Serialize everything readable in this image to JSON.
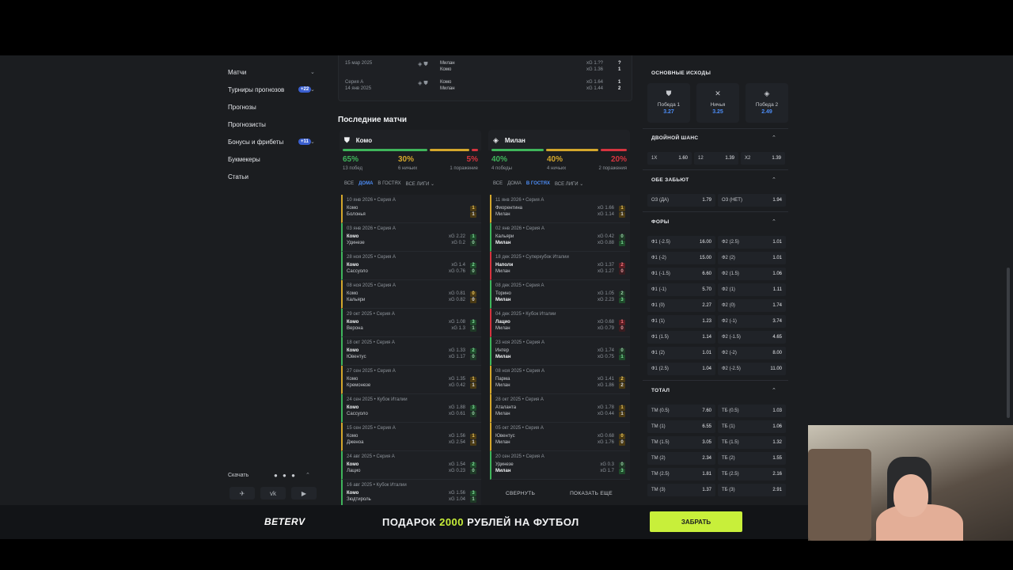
{
  "sidebar": {
    "items": [
      {
        "label": "Матчи",
        "chevron": "⌄"
      },
      {
        "label": "Турниры прогнозов",
        "badge": "+22",
        "chevron": "⌄"
      },
      {
        "label": "Прогнозы"
      },
      {
        "label": "Прогнозисты"
      },
      {
        "label": "Бонусы и фрибеты",
        "badge": "+11",
        "chevron": "⌄"
      },
      {
        "label": "Букмекеры"
      },
      {
        "label": "Статьи"
      }
    ],
    "download_label": "Скачать",
    "download_icons": "● ● ●",
    "socials": [
      "✈",
      "vk",
      "▶"
    ]
  },
  "h2h": [
    {
      "date": "15 мар 2025",
      "league": "",
      "team1": "Милан",
      "team2": "Комо",
      "xg1": "xG 1.??",
      "xg2": "xG 1.36",
      "s1": "?",
      "s2": "1"
    },
    {
      "date": "14 янв 2025",
      "league": "Серия А",
      "team1": "Комо",
      "team2": "Милан",
      "xg1": "xG 1.64",
      "xg2": "xG 1.44",
      "s1": "1",
      "s2": "2"
    }
  ],
  "recent_title": "Последние матчи",
  "teams": [
    {
      "name": "Комо",
      "crest": "⛊",
      "win_pct": "65%",
      "draw_pct": "30%",
      "loss_pct": "5%",
      "win_lbl": "13 побед",
      "draw_lbl": "6 ничьих",
      "loss_lbl": "1 поражение",
      "filters": [
        "ВСЕ",
        "ДОМА",
        "В ГОСТЯХ",
        "ВСЕ ЛИГИ ⌄"
      ],
      "active_filter": 1,
      "matches": [
        {
          "res": "d",
          "meta": "10 янв 2026 • Серия А",
          "t1": "Комо",
          "t2": "Болонья",
          "x1": "",
          "x2": "",
          "s1": "1",
          "s2": "1",
          "bold": 0
        },
        {
          "res": "w",
          "meta": "03 янв 2026 • Серия А",
          "t1": "Комо",
          "t2": "Удинезе",
          "x1": "xG 2.22",
          "x2": "xG 0.2",
          "s1": "1",
          "s2": "0",
          "bold": 1
        },
        {
          "res": "w",
          "meta": "28 ноя 2025 • Серия А",
          "t1": "Комо",
          "t2": "Сассуоло",
          "x1": "xG 1.4",
          "x2": "xG 0.76",
          "s1": "2",
          "s2": "0",
          "bold": 1
        },
        {
          "res": "d",
          "meta": "08 ноя 2025 • Серия А",
          "t1": "Комо",
          "t2": "Кальяри",
          "x1": "xG 0.81",
          "x2": "xG 0.82",
          "s1": "0",
          "s2": "0",
          "bold": 0
        },
        {
          "res": "w",
          "meta": "29 окт 2025 • Серия А",
          "t1": "Комо",
          "t2": "Верона",
          "x1": "xG 1.08",
          "x2": "xG 1.3",
          "s1": "3",
          "s2": "1",
          "bold": 1
        },
        {
          "res": "w",
          "meta": "18 окт 2025 • Серия А",
          "t1": "Комо",
          "t2": "Ювентус",
          "x1": "xG 1.33",
          "x2": "xG 1.17",
          "s1": "2",
          "s2": "0",
          "bold": 1
        },
        {
          "res": "d",
          "meta": "27 сен 2025 • Серия А",
          "t1": "Комо",
          "t2": "Кремонезе",
          "x1": "xG 1.35",
          "x2": "xG 0.42",
          "s1": "1",
          "s2": "1",
          "bold": 0
        },
        {
          "res": "w",
          "meta": "24 сен 2025 • Кубок Италии",
          "t1": "Комо",
          "t2": "Сассуоло",
          "x1": "xG 1.88",
          "x2": "xG 0.61",
          "s1": "3",
          "s2": "0",
          "bold": 1
        },
        {
          "res": "d",
          "meta": "15 сен 2025 • Серия А",
          "t1": "Комо",
          "t2": "Дженоа",
          "x1": "xG 1.56",
          "x2": "xG 2.54",
          "s1": "1",
          "s2": "1",
          "bold": 0
        },
        {
          "res": "w",
          "meta": "24 авг 2025 • Серия А",
          "t1": "Комо",
          "t2": "Лацио",
          "x1": "xG 1.54",
          "x2": "xG 0.23",
          "s1": "2",
          "s2": "0",
          "bold": 1
        },
        {
          "res": "w",
          "meta": "16 авг 2025 • Кубок Италии",
          "t1": "Комо",
          "t2": "Зюдтироль",
          "x1": "xG 1.56",
          "x2": "xG 1.04",
          "s1": "3",
          "s2": "1",
          "bold": 1
        }
      ]
    },
    {
      "name": "Милан",
      "crest": "◈",
      "win_pct": "40%",
      "draw_pct": "40%",
      "loss_pct": "20%",
      "win_lbl": "4 победы",
      "draw_lbl": "4 ничьих",
      "loss_lbl": "2 поражения",
      "filters": [
        "ВСЕ",
        "ДОМА",
        "В ГОСТЯХ",
        "ВСЕ ЛИГИ ⌄"
      ],
      "active_filter": 2,
      "matches": [
        {
          "res": "d",
          "meta": "11 янв 2026 • Серия А",
          "t1": "Фиорентина",
          "t2": "Милан",
          "x1": "xG 1.66",
          "x2": "xG 1.14",
          "s1": "1",
          "s2": "1",
          "bold": 0
        },
        {
          "res": "w",
          "meta": "02 янв 2026 • Серия А",
          "t1": "Кальяри",
          "t2": "Милан",
          "x1": "xG 0.42",
          "x2": "xG 0.88",
          "s1": "0",
          "s2": "1",
          "bold": 2
        },
        {
          "res": "l",
          "meta": "18 дек 2025 • Суперкубок Италии",
          "t1": "Наполи",
          "t2": "Милан",
          "x1": "xG 1.37",
          "x2": "xG 1.27",
          "s1": "2",
          "s2": "0",
          "bold": 1
        },
        {
          "res": "w",
          "meta": "08 дек 2025 • Серия А",
          "t1": "Торино",
          "t2": "Милан",
          "x1": "xG 1.05",
          "x2": "xG 2.23",
          "s1": "2",
          "s2": "3",
          "bold": 2
        },
        {
          "res": "l",
          "meta": "04 дек 2025 • Кубок Италии",
          "t1": "Лацио",
          "t2": "Милан",
          "x1": "xG 0.68",
          "x2": "xG 0.79",
          "s1": "1",
          "s2": "0",
          "bold": 1
        },
        {
          "res": "w",
          "meta": "23 ноя 2025 • Серия А",
          "t1": "Интер",
          "t2": "Милан",
          "x1": "xG 1.74",
          "x2": "xG 0.75",
          "s1": "0",
          "s2": "1",
          "bold": 2
        },
        {
          "res": "d",
          "meta": "08 ноя 2025 • Серия А",
          "t1": "Парма",
          "t2": "Милан",
          "x1": "xG 1.41",
          "x2": "xG 1.86",
          "s1": "2",
          "s2": "2",
          "bold": 0
        },
        {
          "res": "d",
          "meta": "28 окт 2025 • Серия А",
          "t1": "Аталанта",
          "t2": "Милан",
          "x1": "xG 1.78",
          "x2": "xG 0.44",
          "s1": "1",
          "s2": "1",
          "bold": 0
        },
        {
          "res": "d",
          "meta": "05 окт 2025 • Серия А",
          "t1": "Ювентус",
          "t2": "Милан",
          "x1": "xG 0.68",
          "x2": "xG 1.76",
          "s1": "0",
          "s2": "0",
          "bold": 0
        },
        {
          "res": "w",
          "meta": "20 сен 2025 • Серия А",
          "t1": "Удинезе",
          "t2": "Милан",
          "x1": "xG 0.3",
          "x2": "xG 1.7",
          "s1": "0",
          "s2": "3",
          "bold": 2
        }
      ],
      "collapse_label": "СВЕРНУТЬ",
      "more_label": "ПОКАЗАТЬ ЕЩЕ"
    }
  ],
  "odds": {
    "main_title": "ОСНОВНЫЕ ИСХОДЫ",
    "main": [
      {
        "icon": "⛊",
        "label": "Победа 1",
        "value": "3.27"
      },
      {
        "icon": "✕",
        "label": "Ничья",
        "value": "3.25"
      },
      {
        "icon": "◈",
        "label": "Победа 2",
        "value": "2.49"
      }
    ],
    "double_title": "ДВОЙНОЙ ШАНС",
    "double": [
      [
        "1X",
        "1.60"
      ],
      [
        "12",
        "1.39"
      ],
      [
        "X2",
        "1.39"
      ]
    ],
    "btts_title": "ОБЕ ЗАБЬЮТ",
    "btts": [
      [
        "ОЗ (ДА)",
        "1.79"
      ],
      [
        "ОЗ (НЕТ)",
        "1.94"
      ]
    ],
    "handicap_title": "ФОРЫ",
    "handicap": [
      [
        [
          "Ф1 (-2.5)",
          "16.00"
        ],
        [
          "Ф2 (2.5)",
          "1.01"
        ]
      ],
      [
        [
          "Ф1 (-2)",
          "15.00"
        ],
        [
          "Ф2 (2)",
          "1.01"
        ]
      ],
      [
        [
          "Ф1 (-1.5)",
          "6.60"
        ],
        [
          "Ф2 (1.5)",
          "1.06"
        ]
      ],
      [
        [
          "Ф1 (-1)",
          "5.70"
        ],
        [
          "Ф2 (1)",
          "1.11"
        ]
      ],
      [
        [
          "Ф1 (0)",
          "2.27"
        ],
        [
          "Ф2 (0)",
          "1.74"
        ]
      ],
      [
        [
          "Ф1 (1)",
          "1.23"
        ],
        [
          "Ф2 (-1)",
          "3.74"
        ]
      ],
      [
        [
          "Ф1 (1.5)",
          "1.14"
        ],
        [
          "Ф2 (-1.5)",
          "4.65"
        ]
      ],
      [
        [
          "Ф1 (2)",
          "1.01"
        ],
        [
          "Ф2 (-2)",
          "8.00"
        ]
      ],
      [
        [
          "Ф1 (2.5)",
          "1.04"
        ],
        [
          "Ф2 (-2.5)",
          "11.00"
        ]
      ]
    ],
    "total_title": "ТОТАЛ",
    "total": [
      [
        [
          "ТМ (0.5)",
          "7.60"
        ],
        [
          "ТБ (0.5)",
          "1.03"
        ]
      ],
      [
        [
          "ТМ (1)",
          "6.55"
        ],
        [
          "ТБ (1)",
          "1.06"
        ]
      ],
      [
        [
          "ТМ (1.5)",
          "3.05"
        ],
        [
          "ТБ (1.5)",
          "1.32"
        ]
      ],
      [
        [
          "ТМ (2)",
          "2.34"
        ],
        [
          "ТБ (2)",
          "1.55"
        ]
      ],
      [
        [
          "ТМ (2.5)",
          "1.81"
        ],
        [
          "ТБ (2.5)",
          "2.16"
        ]
      ],
      [
        [
          "ТМ (3)",
          "1.37"
        ],
        [
          "ТБ (3)",
          "2.91"
        ]
      ],
      [
        [
          "ТМ (3.5)",
          "1.25"
        ],
        [
          "ТБ (3.5)",
          "3.59"
        ]
      ]
    ]
  },
  "banner": {
    "logo": "BETERV",
    "text_pre": "ПОДАРОК ",
    "text_hl": "2000",
    "text_post": " РУБЛЕЙ НА ФУТБОЛ",
    "button": "ЗАБРАТЬ"
  },
  "colors": {
    "win": "#3fb55b",
    "draw": "#d4a72c",
    "loss": "#d6343f",
    "accent": "#4c8cf5",
    "promo": "#c8ef3a"
  }
}
